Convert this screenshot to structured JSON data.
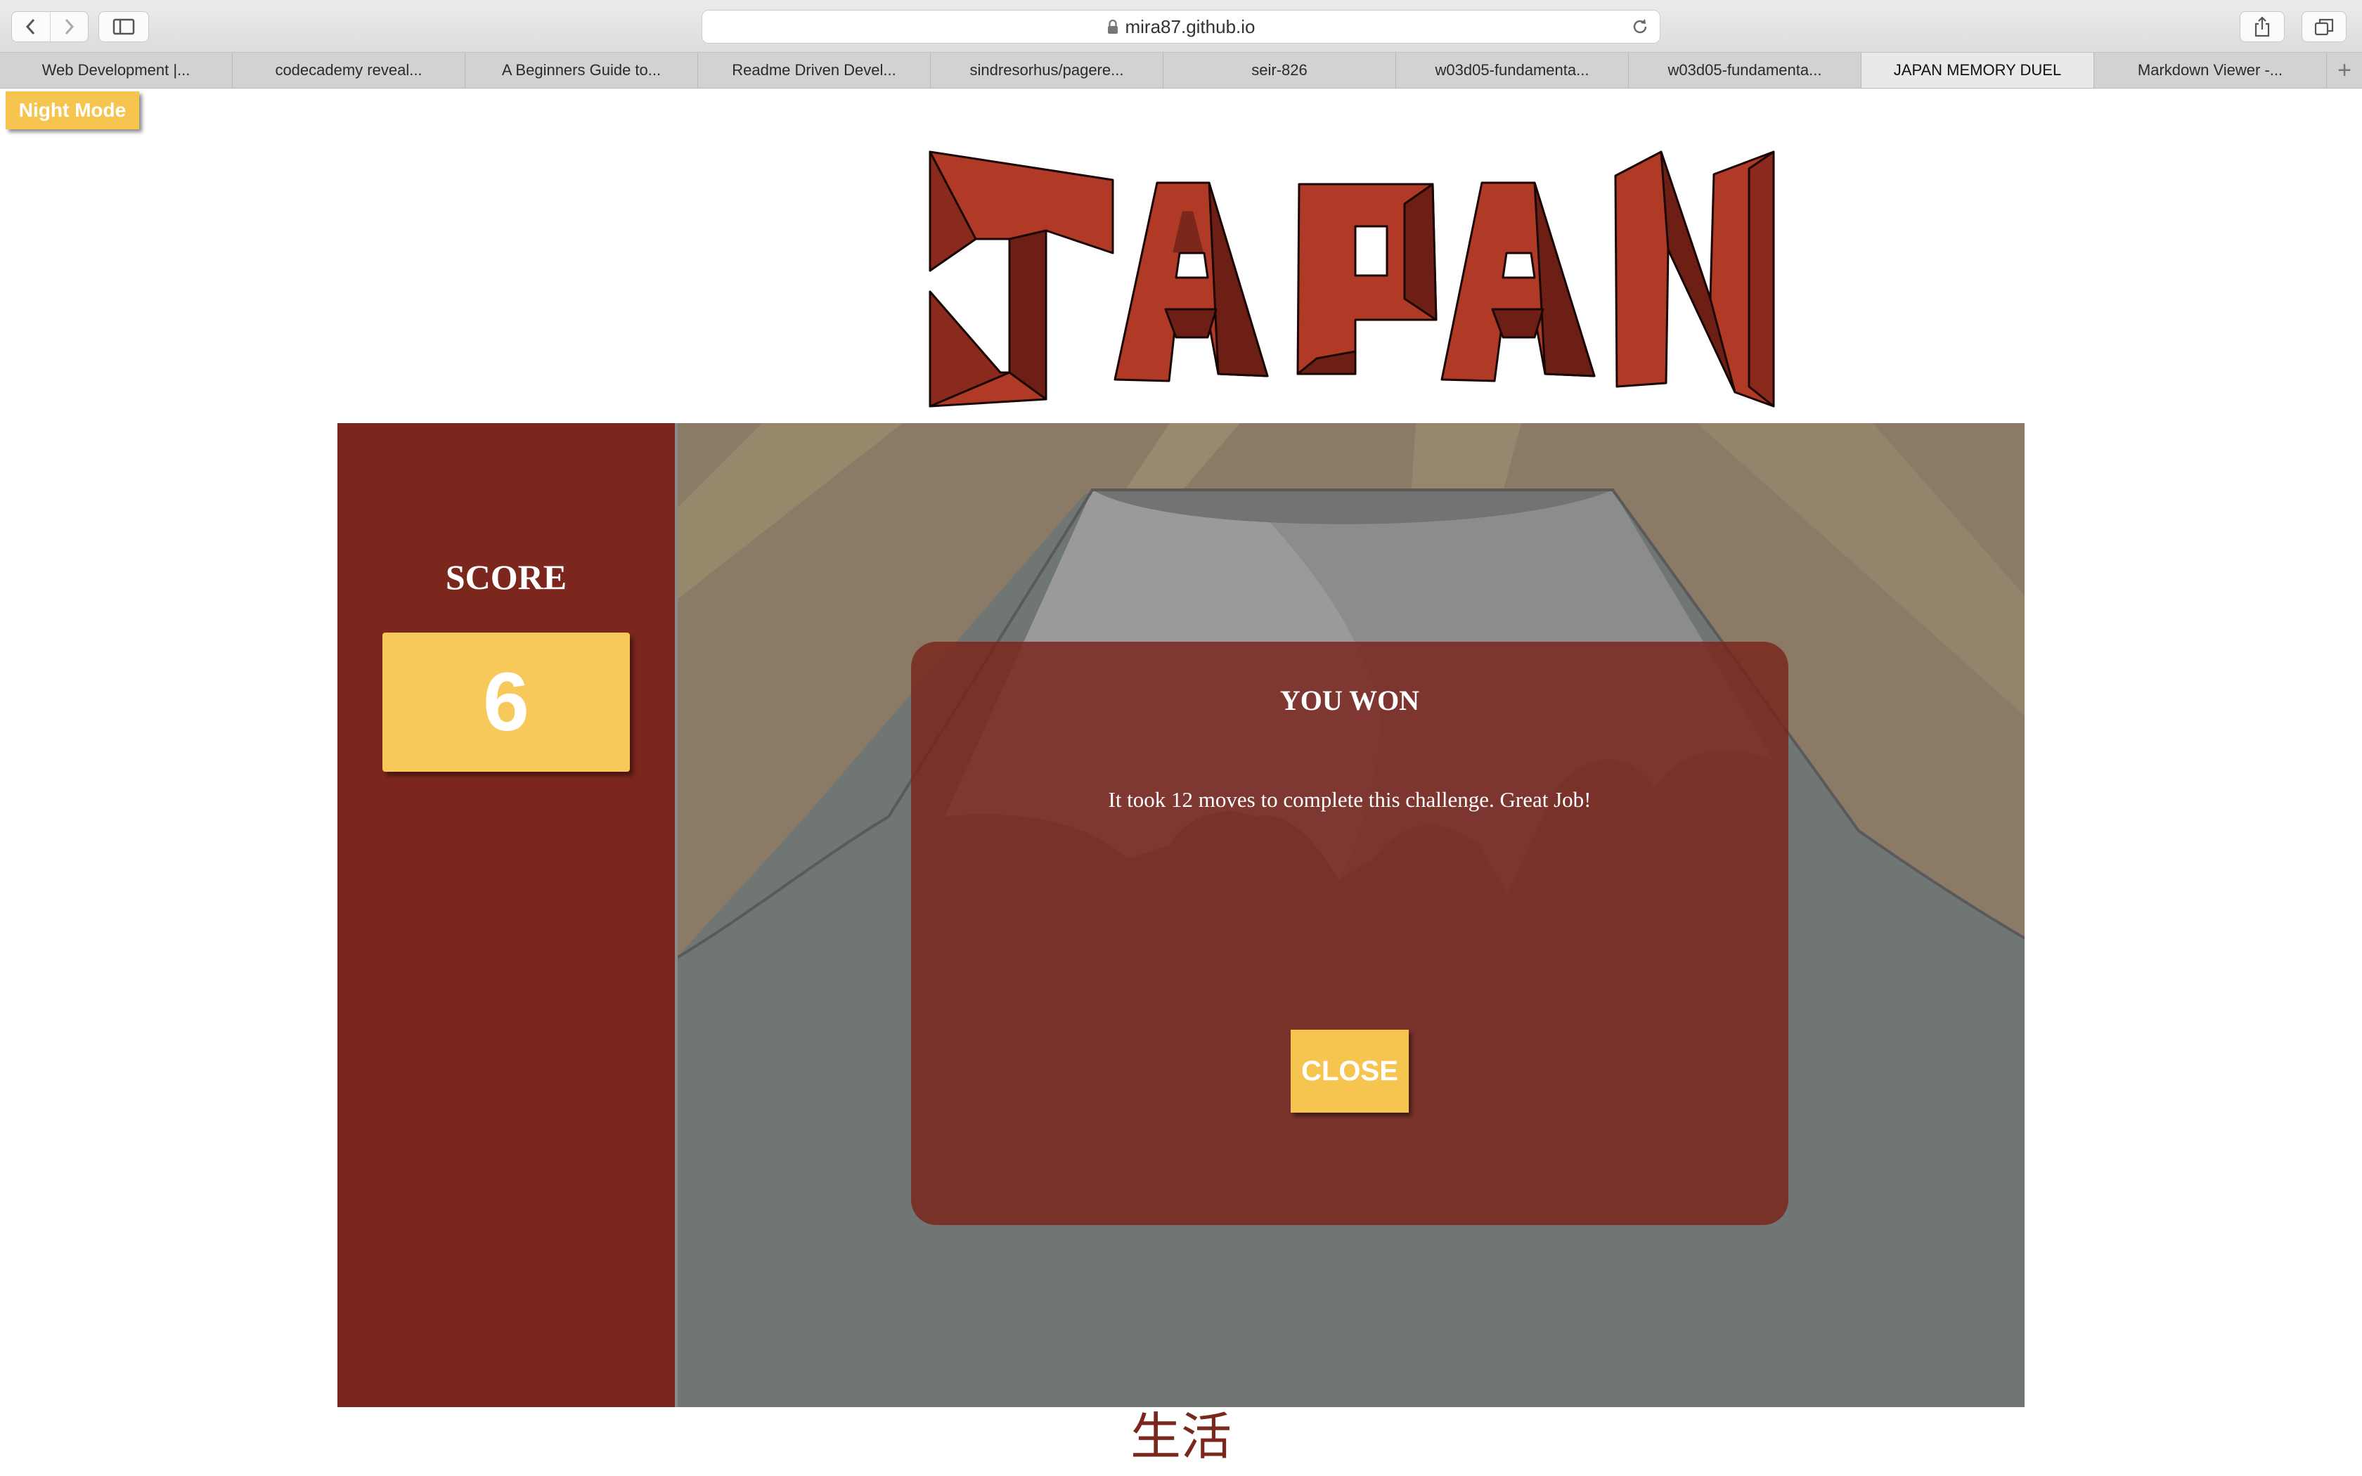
{
  "browser": {
    "url": "mira87.github.io",
    "tabs": [
      {
        "label": "Web Development |..."
      },
      {
        "label": "codecademy reveal..."
      },
      {
        "label": "A Beginners Guide to..."
      },
      {
        "label": "Readme Driven Devel..."
      },
      {
        "label": "sindresorhus/pagere..."
      },
      {
        "label": "seir-826"
      },
      {
        "label": "w03d05-fundamenta..."
      },
      {
        "label": "w03d05-fundamenta..."
      },
      {
        "label": "JAPAN MEMORY DUEL"
      },
      {
        "label": "Markdown Viewer -..."
      }
    ],
    "active_tab_index": 8,
    "new_tab_glyph": "+"
  },
  "page": {
    "night_mode_label": "Night Mode",
    "logo_text": "JAPAN",
    "footer_kanji": "生活"
  },
  "score": {
    "label": "SCORE",
    "value": "6"
  },
  "modal": {
    "title": "YOU WON",
    "message": "It took 12 moves to complete this challenge. Great Job!",
    "close_label": "CLOSE"
  },
  "colors": {
    "accent_yellow": "#f6c54f",
    "panel_red": "#7b271d",
    "logo_red": "#b03a26",
    "board_gray": "#6f7674"
  },
  "icons": [
    "back-icon",
    "forward-icon",
    "sidebar-icon",
    "lock-icon",
    "reload-icon",
    "share-icon",
    "tabs-overview-icon"
  ]
}
